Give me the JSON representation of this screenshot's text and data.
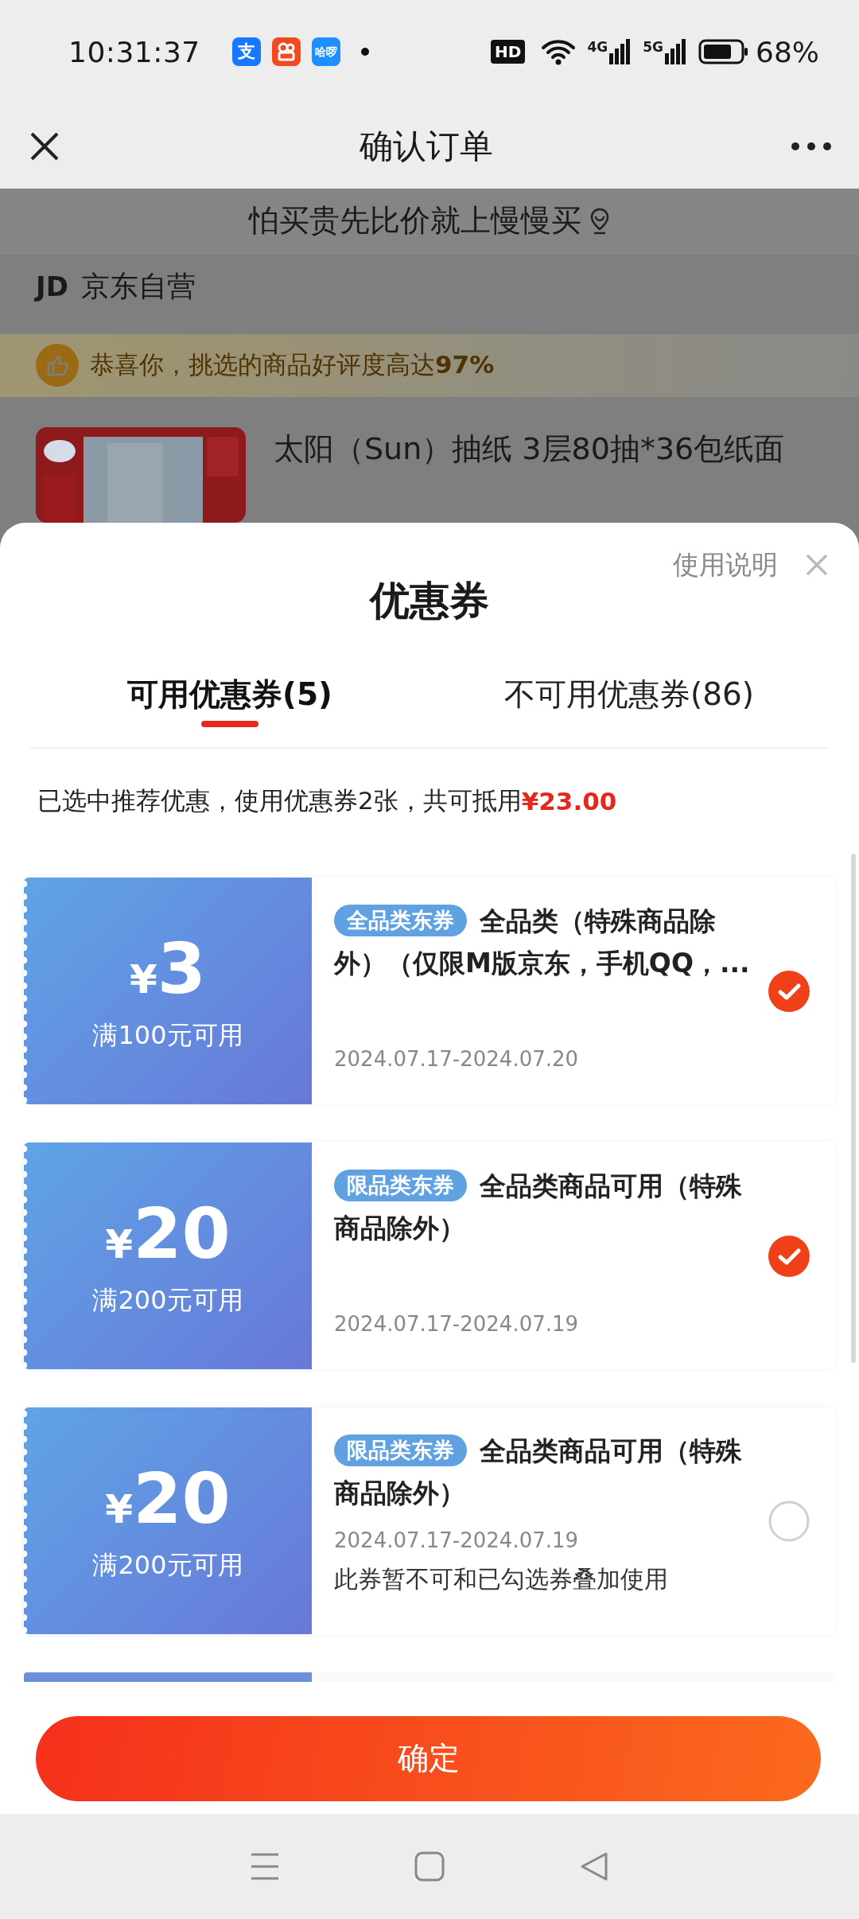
{
  "status_bar": {
    "time": "10:31:37",
    "app_icons": [
      {
        "kind": "text",
        "label": "支",
        "color": "#1677ff"
      },
      {
        "kind": "camera",
        "color": "#f04a1e"
      },
      {
        "kind": "text",
        "label": "哈啰",
        "color": "#1e8fff"
      }
    ],
    "hd_badge": "HD",
    "networks": [
      "4G",
      "5G"
    ],
    "battery": "68%"
  },
  "header": {
    "title": "确认订单"
  },
  "order_page": {
    "banner": "怕买贵先比价就上慢慢买",
    "shop_logo": "JD",
    "shop": "京东自营",
    "notice": "恭喜你，挑选的商品好评度高达**97%**",
    "product_title": "太阳（Sun）抽纸 3层80抽*36包纸面"
  },
  "coupon_sheet": {
    "title": "优惠券",
    "help_link": "使用说明",
    "tabs": [
      {
        "label": "可用优惠券(5)",
        "selected": true
      },
      {
        "label": "不可用优惠券(86)",
        "selected": false
      }
    ],
    "summary": "已选中推荐优惠，使用优惠券2张，共可抵用",
    "summary_amount": "¥23.00",
    "coupons": [
      {
        "currency": "¥",
        "amount": "3",
        "threshold": "满100元可用",
        "tag": "全品类东券",
        "description": "全品类（特殊商品除外）（仅限M版京东，手机QQ，...",
        "validity": "2024.07.17-2024.07.20",
        "selected": true
      },
      {
        "currency": "¥",
        "amount": "20",
        "threshold": "满200元可用",
        "tag": "限品类东券",
        "description": "全品类商品可用（特殊商品除外）",
        "validity": "2024.07.17-2024.07.19",
        "selected": true
      },
      {
        "currency": "¥",
        "amount": "20",
        "threshold": "满200元可用",
        "tag": "限品类东券",
        "description": "全品类商品可用（特殊商品除外）",
        "validity": "2024.07.17-2024.07.19",
        "note": "此券暂不可和已勾选券叠加使用",
        "selected": false
      }
    ],
    "more_coupons_below": true,
    "confirm_button": "确定"
  }
}
